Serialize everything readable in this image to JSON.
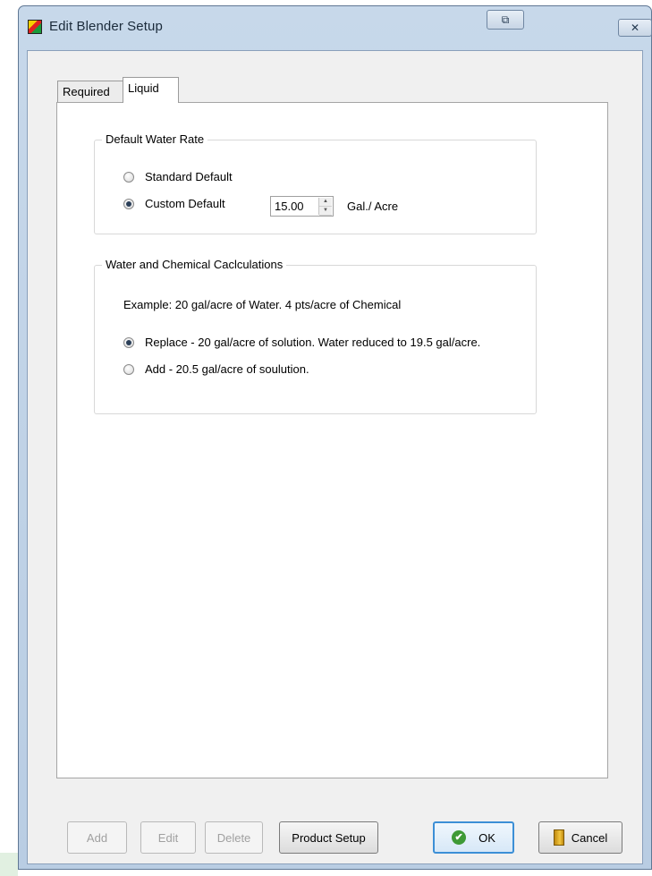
{
  "window": {
    "title": "Edit Blender Setup",
    "restore_icon": "restore-window-icon",
    "close_icon": "close-icon",
    "restore_glyph": "⧉",
    "close_glyph": "✕"
  },
  "tabs": [
    {
      "label": "Required",
      "selected": false
    },
    {
      "label": "Liquid",
      "selected": true
    }
  ],
  "water_rate": {
    "legend": "Default Water Rate",
    "options": [
      {
        "label": "Standard Default",
        "checked": false
      },
      {
        "label": "Custom Default",
        "checked": true
      }
    ],
    "value": "15.00",
    "unit": "Gal./ Acre"
  },
  "calc": {
    "legend": "Water and Chemical Caclculations",
    "example": "Example: 20 gal/acre of Water. 4 pts/acre of Chemical",
    "options": [
      {
        "label": "Replace - 20 gal/acre of solution.  Water reduced to 19.5 gal/acre.",
        "checked": true
      },
      {
        "label": "Add - 20.5 gal/acre of soulution.",
        "checked": false
      }
    ]
  },
  "buttons": {
    "add": "Add",
    "edit": "Edit",
    "delete": "Delete",
    "product_setup": "Product Setup",
    "ok": "OK",
    "cancel": "Cancel"
  },
  "icons": {
    "ok": "check-icon",
    "cancel": "door-exit-icon",
    "ok_glyph": "✔"
  }
}
